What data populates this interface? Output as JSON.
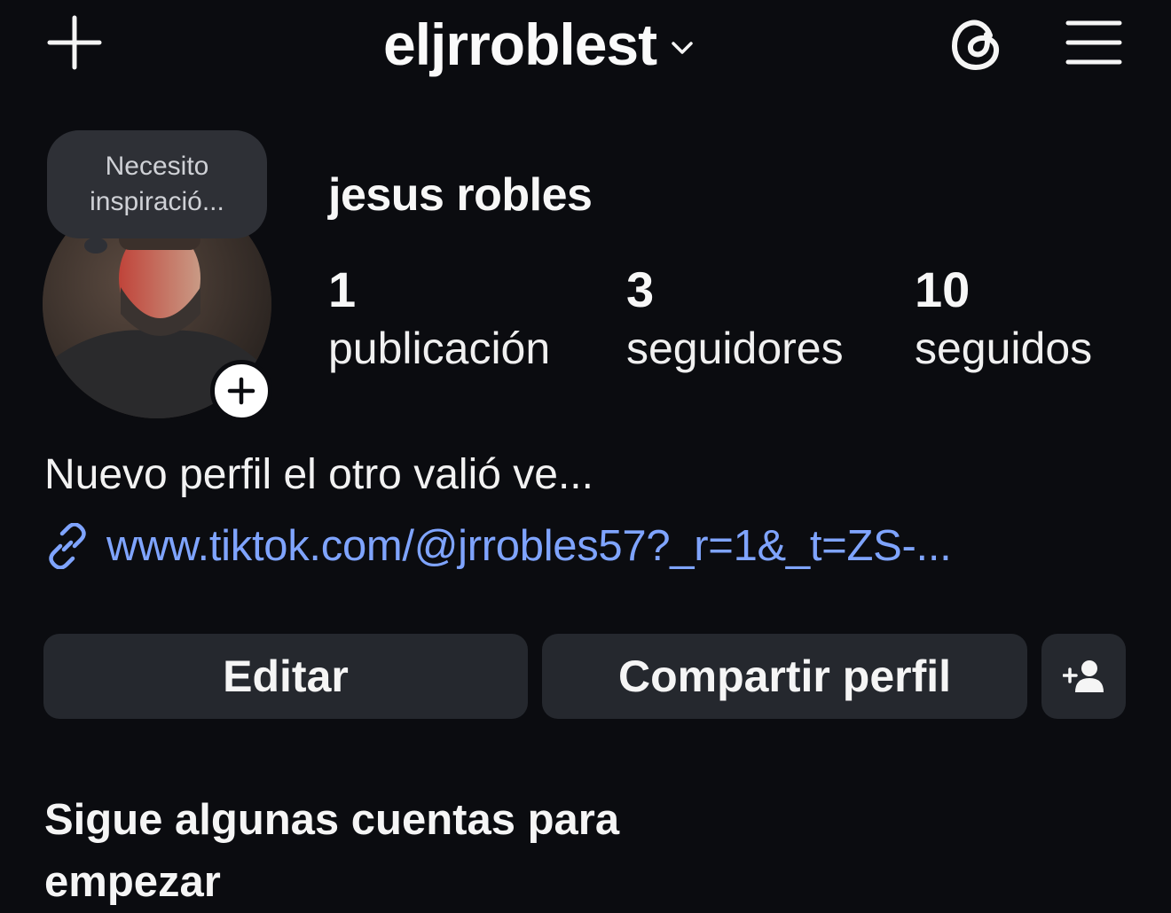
{
  "header": {
    "username": "eljrroblest",
    "icons": [
      "plus-icon",
      "chevron-down-icon",
      "threads-icon",
      "hamburger-menu-icon"
    ]
  },
  "profile": {
    "note": "Necesito inspiració...",
    "full_name": "jesus robles",
    "stats": [
      {
        "count": "1",
        "label": "publicación"
      },
      {
        "count": "3",
        "label": "seguidores"
      },
      {
        "count": "10",
        "label": "seguidos"
      }
    ],
    "bio": "Nuevo perfil el otro valió ve...",
    "link": "www.tiktok.com/@jrrobles57?_r=1&_t=ZS-..."
  },
  "actions": {
    "edit_label": "Editar",
    "share_label": "Compartir perfil",
    "add_user_icon": "add-person-icon"
  },
  "suggestions": {
    "title": "Sigue algunas cuentas para empezar"
  },
  "colors": {
    "background": "#0b0c10",
    "button": "#25282e",
    "link": "#7fa4ff",
    "note_bubble": "#2e3036"
  }
}
